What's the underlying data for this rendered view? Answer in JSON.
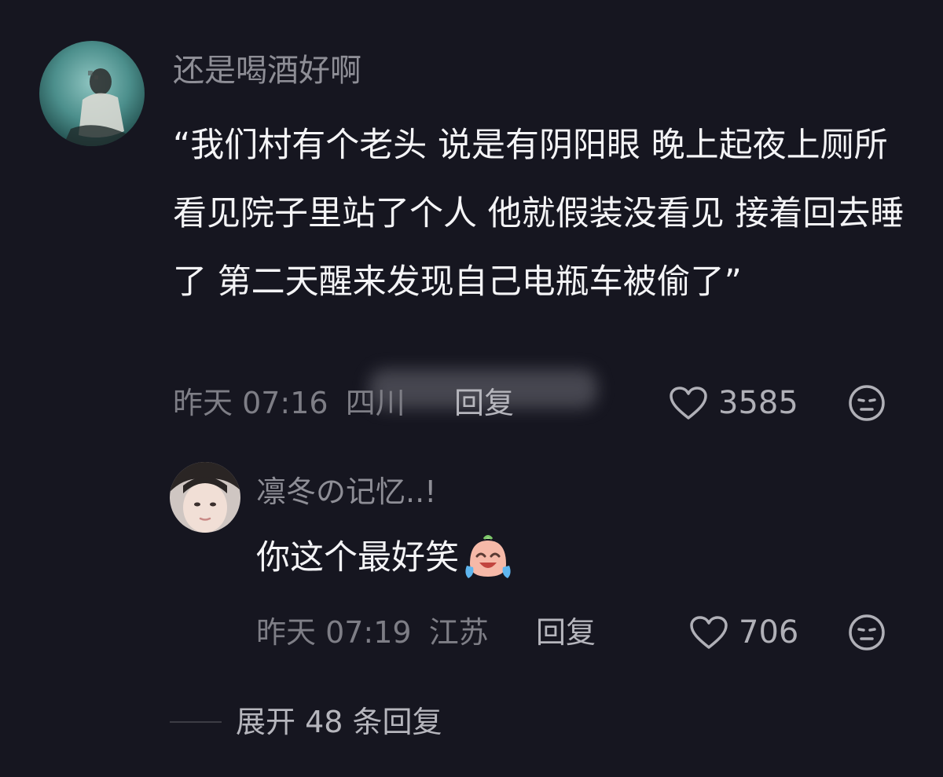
{
  "comment": {
    "username": "还是喝酒好啊",
    "avatar_icon": "user-avatar-icon",
    "text": "“我们村有个老头 说是有阴阳眼 晚上起夜上厕所 看见院子里站了个人 他就假装没看见 接着回去睡了 第二天醒来发现自己电瓶车被偷了”",
    "time": "昨天 07:16",
    "location": "四川",
    "reply_label": "回复",
    "like_count": "3585",
    "like_icon": "heart-outline-icon",
    "dislike_icon": "dislike-face-icon"
  },
  "reply": {
    "username": "凛冬の记忆..!",
    "avatar_icon": "user-avatar-icon",
    "text": "你这个最好笑",
    "emoji": "laughing-crying-emoji",
    "time": "昨天 07:19",
    "location": "江苏",
    "reply_label": "回复",
    "like_count": "706",
    "like_icon": "heart-outline-icon",
    "dislike_icon": "dislike-face-icon"
  },
  "expand": {
    "label": "展开 48 条回复"
  },
  "colors": {
    "background": "#161620",
    "username": "#8e8e96",
    "text": "#f4f4f6",
    "meta": "#7e7e86"
  }
}
